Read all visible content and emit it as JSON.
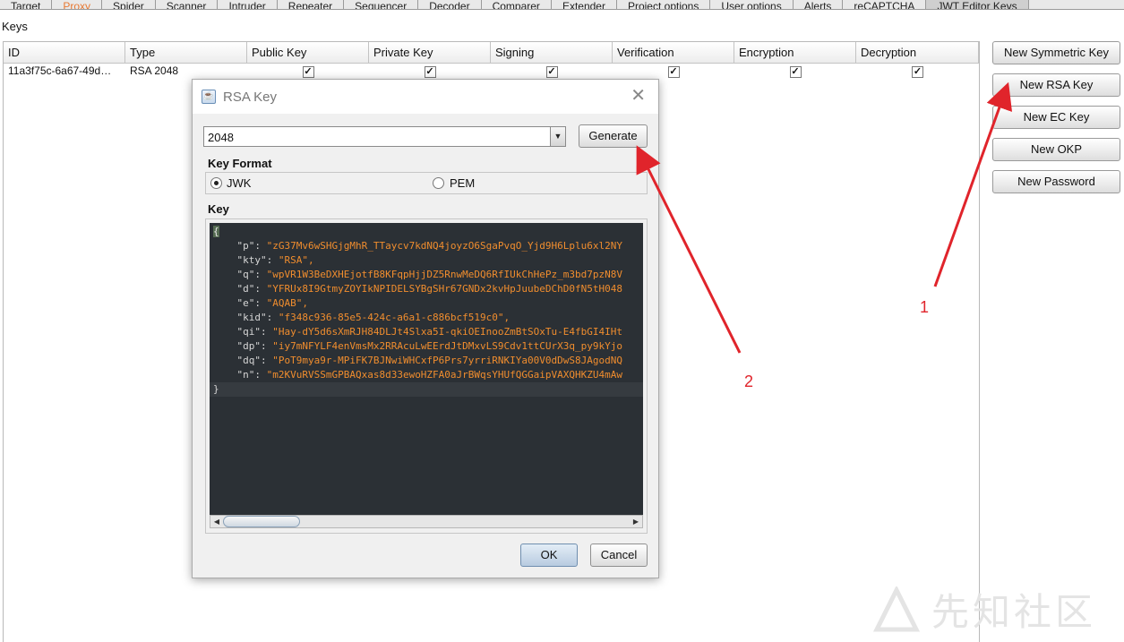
{
  "tabs": [
    {
      "label": "Target"
    },
    {
      "label": "Proxy",
      "color": "#e87933"
    },
    {
      "label": "Spider"
    },
    {
      "label": "Scanner"
    },
    {
      "label": "Intruder"
    },
    {
      "label": "Repeater"
    },
    {
      "label": "Sequencer"
    },
    {
      "label": "Decoder"
    },
    {
      "label": "Comparer"
    },
    {
      "label": "Extender"
    },
    {
      "label": "Project options"
    },
    {
      "label": "User options"
    },
    {
      "label": "Alerts"
    },
    {
      "label": "reCAPTCHA"
    },
    {
      "label": "JWT Editor Keys"
    }
  ],
  "keys_label": "Keys",
  "table": {
    "headers": [
      "ID",
      "Type",
      "Public Key",
      "Private Key",
      "Signing",
      "Verification",
      "Encryption",
      "Decryption"
    ],
    "rows": [
      {
        "id": "11a3f75c-6a67-49d…",
        "type": "RSA 2048",
        "checks": [
          true,
          true,
          true,
          true,
          true,
          true
        ]
      }
    ]
  },
  "side_buttons": {
    "new_symmetric": "New Symmetric Key",
    "new_rsa": "New RSA Key",
    "new_ec": "New EC Key",
    "new_okp": "New OKP",
    "new_password": "New Password"
  },
  "dialog": {
    "title": "RSA Key",
    "key_size": "2048",
    "generate_label": "Generate",
    "key_format_label": "Key Format",
    "formats": [
      {
        "label": "JWK",
        "selected": true
      },
      {
        "label": "PEM",
        "selected": false
      }
    ],
    "key_label": "Key",
    "open_brace": "{",
    "close_brace": "}",
    "key_lines": [
      {
        "key": "\"p\": ",
        "value": "\"zG37Mv6wSHGjgMhR_TTaycv7kdNQ4joyzO6SgaPvqO_Yjd9H6Lplu6xl2NY"
      },
      {
        "key": "\"kty\": ",
        "value": "\"RSA\","
      },
      {
        "key": "\"q\": ",
        "value": "\"wpVR1W3BeDXHEjotfB8KFqpHjjDZ5RnwMeDQ6RfIUkChHePz_m3bd7pzN8V"
      },
      {
        "key": "\"d\": ",
        "value": "\"YFRUx8I9GtmyZOYIkNPIDELSYBgSHr67GNDx2kvHpJuubeDChD0fN5tH048"
      },
      {
        "key": "\"e\": ",
        "value": "\"AQAB\","
      },
      {
        "key": "\"kid\": ",
        "value": "\"f348c936-85e5-424c-a6a1-c886bcf519c0\","
      },
      {
        "key": "\"qi\": ",
        "value": "\"Hay-dY5d6sXmRJH84DLJt4Slxa5I-qkiOEInooZmBtSOxTu-E4fbGI4IHt"
      },
      {
        "key": "\"dp\": ",
        "value": "\"iy7mNFYLF4enVmsMx2RRAcuLwEErdJtDMxvLS9Cdv1ttCUrX3q_py9kYjo"
      },
      {
        "key": "\"dq\": ",
        "value": "\"PoT9mya9r-MPiFK7BJNwiWHCxfP6Prs7yrriRNKIYa00V0dDwS8JAgodNQ"
      },
      {
        "key": "\"n\": ",
        "value": "\"m2KVuRVSSmGPBAQxas8d33ewoHZFA0aJrBWqsYHUfQGGaipVAXQHKZU4mAw"
      }
    ],
    "ok_label": "OK",
    "cancel_label": "Cancel"
  },
  "annotations": {
    "one": "1",
    "two": "2",
    "color": "#e0242b"
  },
  "watermark": "先知社区"
}
